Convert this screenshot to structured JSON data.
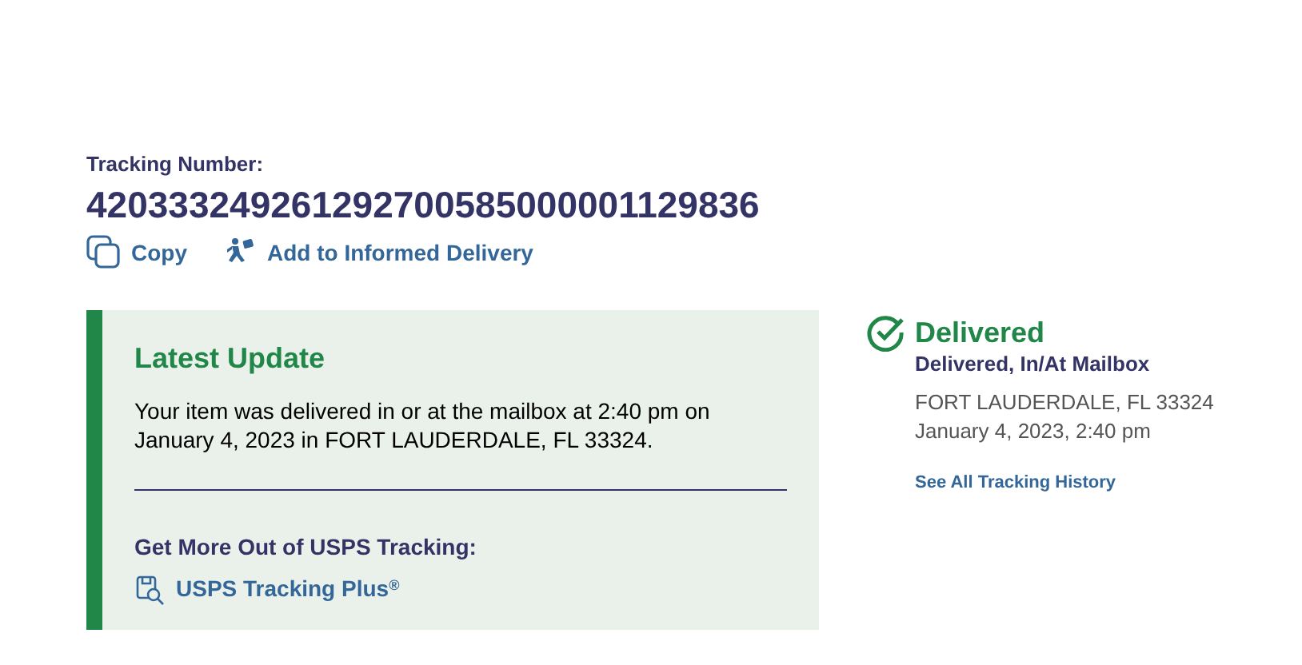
{
  "tracking": {
    "label": "Tracking Number:",
    "number": "420333249261292700585000001129836"
  },
  "actions": [
    {
      "kind": "copy",
      "label": "Copy"
    },
    {
      "kind": "informed",
      "label": "Add to Informed Delivery"
    }
  ],
  "latest_update": {
    "title": "Latest Update",
    "message": "Your item was delivered in or at the mailbox at 2:40 pm on January 4, 2023 in FORT LAUDERDALE, FL 33324.",
    "promo_heading": "Get More Out of USPS Tracking:",
    "promo_link": "USPS Tracking Plus$^{®}$"
  },
  "status": {
    "title": "Delivered",
    "detail": "Delivered, In/At Mailbox",
    "location": "FORT LAUDERDALE, FL 33324",
    "datetime": "January 4, 2023, 2:40 pm",
    "history_link": "See All Tracking History"
  }
}
